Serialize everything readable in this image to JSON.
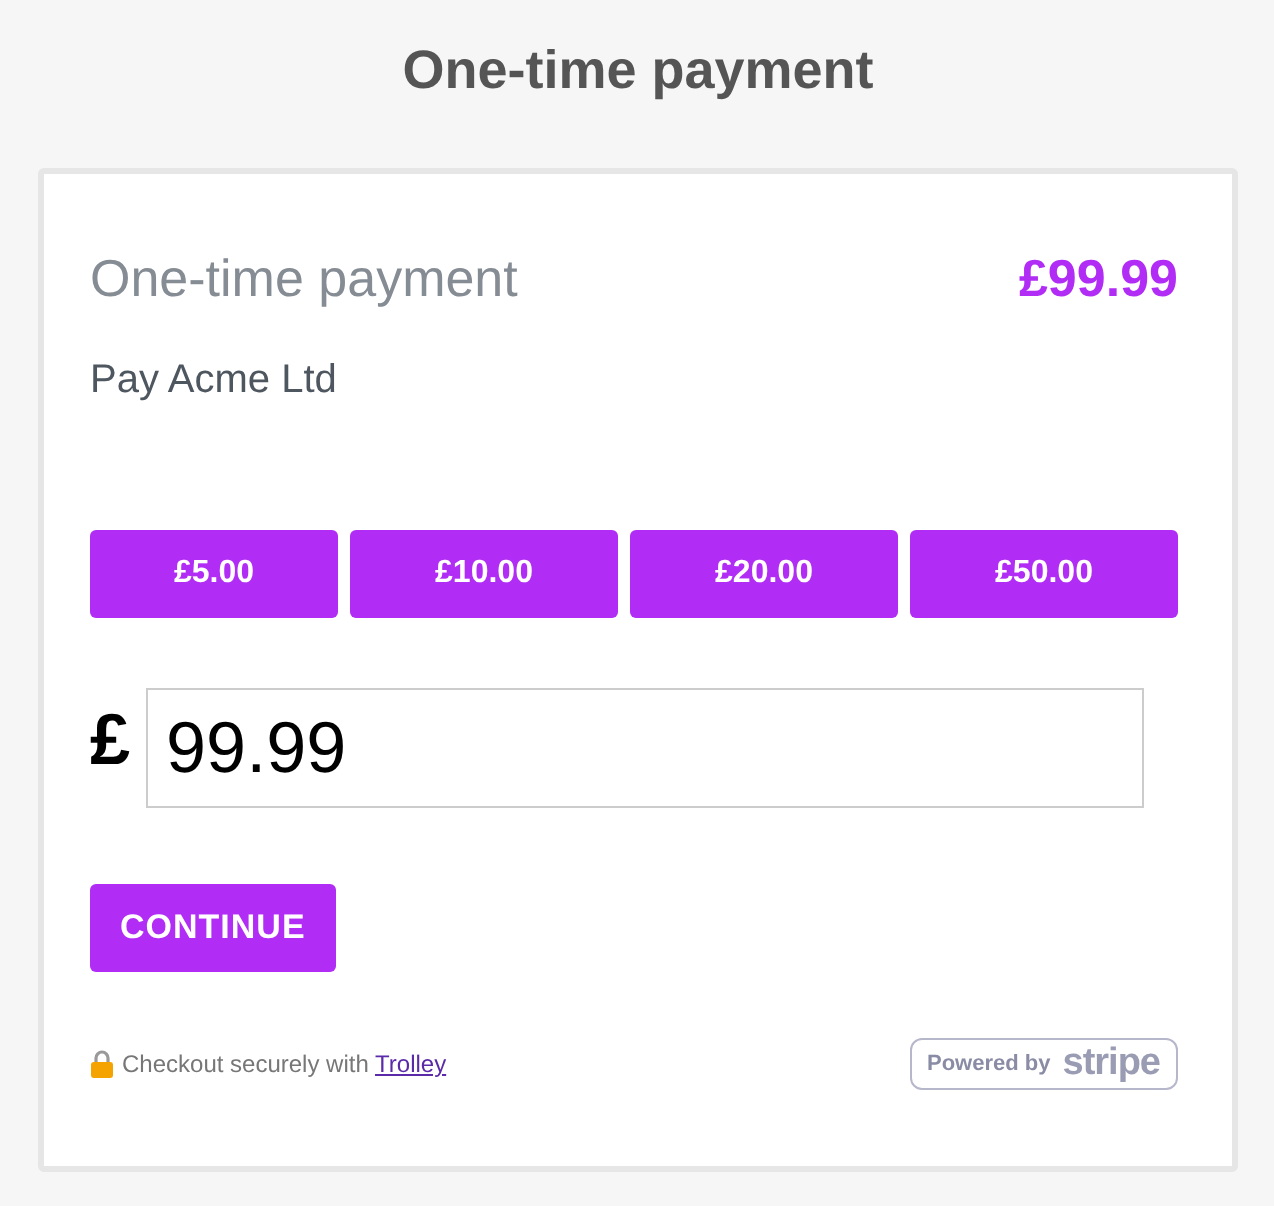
{
  "page_title": "One-time payment",
  "card": {
    "title": "One-time payment",
    "amount": "£99.99",
    "payee": "Pay Acme Ltd",
    "presets": [
      "£5.00",
      "£10.00",
      "£20.00",
      "£50.00"
    ],
    "currency_symbol": "£",
    "amount_field": {
      "value": "99.99"
    },
    "continue_button": "CONTINUE",
    "footer": {
      "text": "Checkout securely with",
      "link": "Trolley",
      "badge": {
        "prefix": "Powered by",
        "brand": "stripe"
      }
    }
  }
}
